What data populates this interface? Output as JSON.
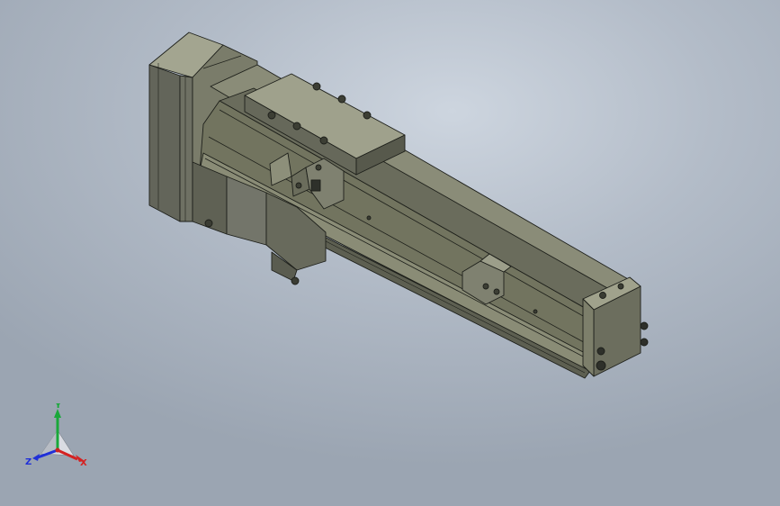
{
  "scene": {
    "background_top": "#cdd5df",
    "background_bottom": "#9ba5b2",
    "model_color": "#7b7d6a",
    "model_dark": "#4f5146",
    "model_light": "#9c9e8a",
    "edge_color": "#1d1f1a"
  },
  "triad": {
    "x_label": "X",
    "y_label": "Y",
    "z_label": "Z",
    "x_color": "#d42222",
    "y_color": "#19a83a",
    "z_color": "#2030d8"
  }
}
